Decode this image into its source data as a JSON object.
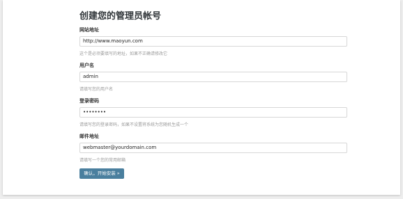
{
  "title": "创建您的管理员帐号",
  "fields": [
    {
      "label": "网站地址",
      "value": "http://www.maoyun.com",
      "hint": "这个是必须要填写的地址，如果不正确请修改它"
    },
    {
      "label": "用户名",
      "value": "admin",
      "hint": "请填写您的用户名"
    },
    {
      "label": "登录密码",
      "value": "••••••••",
      "hint": "请填写您的登录密码，如果不设置将系统为您随机生成一个"
    },
    {
      "label": "邮件地址",
      "value": "webmaster@yourdomain.com",
      "hint": "请填写一个您的常用邮箱"
    }
  ],
  "submit_label": "确认，开始安装 »",
  "colors": {
    "button": "#4a7f9e",
    "background": "#eeeeee",
    "panel": "#ffffff"
  }
}
